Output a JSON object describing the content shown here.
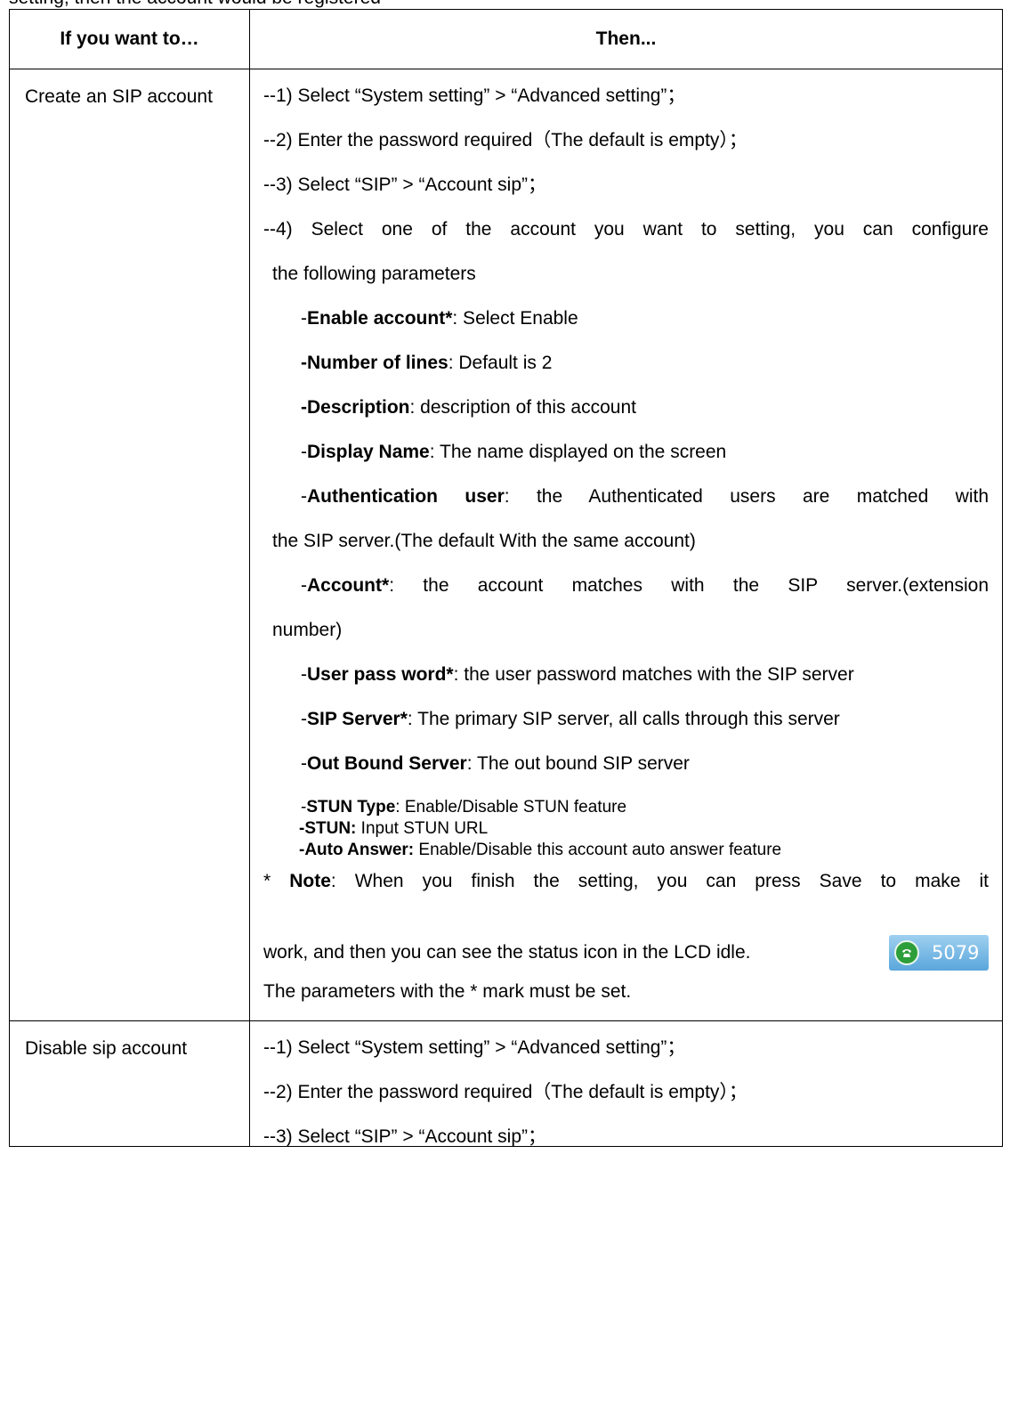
{
  "top_fragment": "setting, then the account would be registered",
  "table": {
    "header": {
      "col1": "If you want to…",
      "col2": "Then..."
    },
    "row1": {
      "label": "Create an SIP account",
      "step1": "--1) Select “System setting” > “Advanced setting”；",
      "step2": "--2) Enter the password required（The default is empty）；",
      "step3": "--3) Select “SIP” > “Account sip”；",
      "step4a": "--4) Select one of the account you want to setting, you can configure",
      "step4b": "the following parameters",
      "params": [
        {
          "prefix": "-",
          "name": "Enable account*",
          "desc": ": Select Enable"
        },
        {
          "prefix": "",
          "name": "-Number of lines",
          "desc": ": Default is 2"
        },
        {
          "prefix": "",
          "name": "-Description",
          "desc": ": description of this account"
        },
        {
          "prefix": "-",
          "name": "Display Name",
          "desc": ": The name displayed on the screen"
        },
        {
          "prefix": "-",
          "name": "Authentication user",
          "desc": ": the Authenticated users are matched with"
        },
        {
          "prefix": "-",
          "name": "Account*",
          "desc": ": the account matches with the SIP server.(extension"
        },
        {
          "prefix": "-",
          "name": "User pass word*",
          "desc": ": the user password matches with the SIP server"
        },
        {
          "prefix": "-",
          "name": "SIP Server*",
          "desc": ": The primary SIP server, all calls through this server"
        },
        {
          "prefix": "-",
          "name": "Out Bound Server",
          "desc": ": The out bound SIP server"
        },
        {
          "prefix": "-",
          "name": "STUN Type",
          "desc": ": Enable/Disable STUN feature"
        },
        {
          "prefix": "",
          "name": "-STUN:",
          "desc": " Input STUN URL"
        },
        {
          "prefix": "",
          "name": "-Auto Answer:",
          "desc": " Enable/Disable this account auto answer feature"
        }
      ],
      "auth_cont": "the SIP server.(The default With the same account)",
      "account_cont": "number)",
      "note_prefix": "* ",
      "note_bold": "Note",
      "note_text": ": When you finish the setting, you can press Save to make it",
      "note_cont": "work, and then you can see the status icon in the LCD idle.",
      "status_icon": "phone-icon",
      "status_number": "5079",
      "status_color": "#2e9e3a",
      "note_last": "The parameters with the * mark must be set."
    },
    "row2": {
      "label": "Disable sip account",
      "step1": "--1) Select “System setting” > “Advanced setting”；",
      "step2": "--2) Enter the password required（The default is empty）；",
      "step3": "--3) Select “SIP” > “Account sip”；"
    }
  }
}
